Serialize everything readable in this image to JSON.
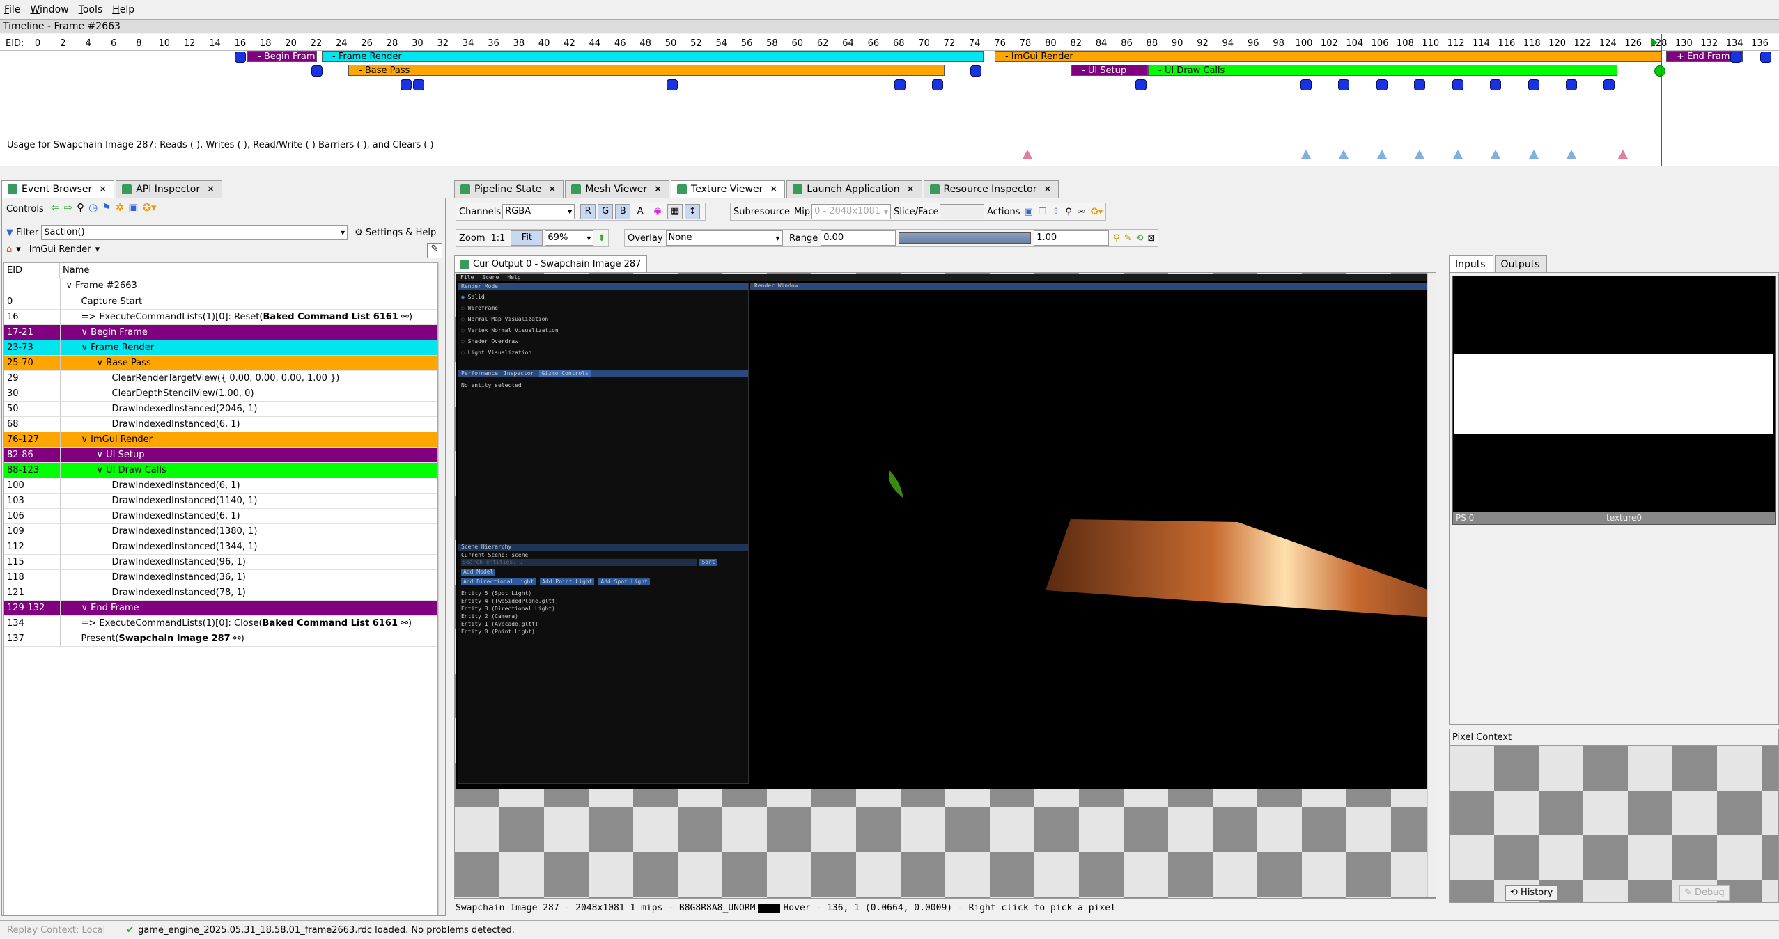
{
  "menu": [
    "File",
    "Window",
    "Tools",
    "Help"
  ],
  "timeline": {
    "title": "Timeline - Frame #2663",
    "eid_label": "EID:",
    "ticks": [
      "0",
      "2",
      "4",
      "6",
      "8",
      "10",
      "12",
      "14",
      "16",
      "18",
      "20",
      "22",
      "24",
      "26",
      "28",
      "30",
      "32",
      "34",
      "36",
      "38",
      "40",
      "42",
      "44",
      "46",
      "48",
      "50",
      "52",
      "54",
      "56",
      "58",
      "60",
      "62",
      "64",
      "66",
      "68",
      "70",
      "72",
      "74",
      "76",
      "78",
      "80",
      "82",
      "84",
      "86",
      "88",
      "90",
      "92",
      "94",
      "96",
      "98",
      "100",
      "102",
      "104",
      "106",
      "108",
      "110",
      "112",
      "114",
      "116",
      "118",
      "120",
      "122",
      "124",
      "126",
      "128",
      "130",
      "132",
      "134",
      "136"
    ],
    "bars": [
      {
        "label": "- Begin Frame",
        "color": "#800080",
        "text_color": "#ffffff"
      },
      {
        "label": "- Frame Render",
        "color": "#00e5ee",
        "text_color": "#000000"
      },
      {
        "label": "- Base Pass",
        "color": "#ffa500",
        "text_color": "#000000"
      },
      {
        "label": "- ImGui Render",
        "color": "#ffa500",
        "text_color": "#000000"
      },
      {
        "label": "- UI Setup",
        "color": "#800080",
        "text_color": "#ffffff"
      },
      {
        "label": "- UI Draw Calls",
        "color": "#00ff00",
        "text_color": "#000000"
      },
      {
        "label": "+ End Frame",
        "color": "#800080",
        "text_color": "#ffffff"
      }
    ],
    "usage_text": "Usage for Swapchain Image 287: Reads (  ), Writes (  ), Read/Write (  ) Barriers (  ), and Clears (  )"
  },
  "left_tabs": [
    "Event Browser",
    "API Inspector"
  ],
  "controls_label": "Controls",
  "filter": {
    "label": "Filter",
    "value": "$action()",
    "settings": "Settings & Help"
  },
  "breadcrumb": "ImGui Render",
  "columns": [
    "EID",
    "Name"
  ],
  "events": [
    {
      "eid": "",
      "name": "Frame #2663",
      "indent": 0,
      "color": ""
    },
    {
      "eid": "0",
      "name": "Capture Start",
      "indent": 1,
      "color": ""
    },
    {
      "eid": "16",
      "name": "=> ExecuteCommandLists(1)[0]: Reset(",
      "bold": "Baked Command List 6161",
      "tail": ")",
      "indent": 1,
      "color": ""
    },
    {
      "eid": "17-21",
      "name": "Begin Frame",
      "indent": 1,
      "color": "#800080",
      "fg": "#ffffff"
    },
    {
      "eid": "23-73",
      "name": "Frame Render",
      "indent": 1,
      "color": "#00e5ee",
      "fg": "#000000"
    },
    {
      "eid": "25-70",
      "name": "Base Pass",
      "indent": 2,
      "color": "#ffa500",
      "fg": "#000000"
    },
    {
      "eid": "29",
      "name": "ClearRenderTargetView({ 0.00, 0.00, 0.00, 1.00 })",
      "indent": 3,
      "color": ""
    },
    {
      "eid": "30",
      "name": "ClearDepthStencilView(1.00, 0)",
      "indent": 3,
      "color": ""
    },
    {
      "eid": "50",
      "name": "DrawIndexedInstanced(2046, 1)",
      "indent": 3,
      "color": ""
    },
    {
      "eid": "68",
      "name": "DrawIndexedInstanced(6, 1)",
      "indent": 3,
      "color": ""
    },
    {
      "eid": "76-127",
      "name": "ImGui Render",
      "indent": 1,
      "color": "#ffa500",
      "fg": "#000000"
    },
    {
      "eid": "82-86",
      "name": "UI Setup",
      "indent": 2,
      "color": "#800080",
      "fg": "#ffffff"
    },
    {
      "eid": "88-123",
      "name": "UI Draw Calls",
      "indent": 2,
      "color": "#00ff00",
      "fg": "#000000"
    },
    {
      "eid": "100",
      "name": "DrawIndexedInstanced(6, 1)",
      "indent": 3,
      "color": ""
    },
    {
      "eid": "103",
      "name": "DrawIndexedInstanced(1140, 1)",
      "indent": 3,
      "color": ""
    },
    {
      "eid": "106",
      "name": "DrawIndexedInstanced(6, 1)",
      "indent": 3,
      "color": ""
    },
    {
      "eid": "109",
      "name": "DrawIndexedInstanced(1380, 1)",
      "indent": 3,
      "color": ""
    },
    {
      "eid": "112",
      "name": "DrawIndexedInstanced(1344, 1)",
      "indent": 3,
      "color": ""
    },
    {
      "eid": "115",
      "name": "DrawIndexedInstanced(96, 1)",
      "indent": 3,
      "color": ""
    },
    {
      "eid": "118",
      "name": "DrawIndexedInstanced(36, 1)",
      "indent": 3,
      "color": ""
    },
    {
      "eid": "121",
      "name": "DrawIndexedInstanced(78, 1)",
      "indent": 3,
      "color": ""
    },
    {
      "eid": "129-132",
      "name": "End Frame",
      "indent": 1,
      "color": "#800080",
      "fg": "#ffffff"
    },
    {
      "eid": "134",
      "name": "=> ExecuteCommandLists(1)[0]: Close(",
      "bold": "Baked Command List 6161",
      "tail": ")",
      "indent": 1,
      "color": ""
    },
    {
      "eid": "137",
      "name": "Present(",
      "bold": "Swapchain Image 287",
      "tail": ")",
      "indent": 1,
      "color": ""
    }
  ],
  "right_tabs": [
    "Pipeline State",
    "Mesh Viewer",
    "Texture Viewer",
    "Launch Application",
    "Resource Inspector"
  ],
  "toolbar": {
    "channels_label": "Channels",
    "channels_value": "RGBA",
    "r": "R",
    "g": "G",
    "b": "B",
    "a": "A",
    "subresource": "Subresource",
    "mip_label": "Mip",
    "mip_value": "0 - 2048x1081",
    "slice_label": "Slice/Face",
    "actions": "Actions",
    "zoom_label": "Zoom",
    "zoom_1to1": "1:1",
    "fit": "Fit",
    "zoom_value": "69%",
    "overlay_label": "Overlay",
    "overlay_value": "None",
    "range_label": "Range",
    "range_min": "0.00",
    "range_max": "1.00"
  },
  "texture_tab": "Cur Output 0 - Swapchain Image 287",
  "game": {
    "menu": [
      "File",
      "Scene",
      "Help"
    ],
    "render_mode_header": "Render Mode",
    "render_modes": [
      "Solid",
      "Wireframe",
      "Normal Map Visualization",
      "Vertex Normal Visualization",
      "Shader Overdraw",
      "Light Visualization"
    ],
    "window_header": "Render Window",
    "perf_tabs": [
      "Performance",
      "Inspector",
      "Gizmo Controls"
    ],
    "no_entity": "No entity selected",
    "hierarchy_header": "Scene Hierarchy",
    "current_scene": "Current Scene: scene",
    "search_placeholder": "Search entities...",
    "sort": "Sort",
    "add_model": "Add Model",
    "add_buttons": [
      "Add Directional Light",
      "Add Point Light",
      "Add Spot Light"
    ],
    "entities": [
      "Entity 5 (Spot Light)",
      "Entity 4 (TwoSidedPlane.gltf)",
      "Entity 3 (Directional Light)",
      "Entity 2 (Camera)",
      "Entity 1 (Avocado.gltf)",
      "Entity 0 (Point Light)"
    ]
  },
  "texture_status": "Swapchain Image 287 - 2048x1081 1 mips - B8G8R8A8_UNORM",
  "hover_status": "Hover -    136,    1 (0.0664, 0.0009)  - Right click to pick a pixel",
  "io_tabs": [
    "Inputs",
    "Outputs"
  ],
  "thumb": {
    "left": "PS 0",
    "right": "texture0"
  },
  "pixel_context": "Pixel Context",
  "history": "History",
  "debug": "Debug",
  "statusbar": {
    "replay": "Replay Context: Local",
    "loaded": "game_engine_2025.05.31_18.58.01_frame2663.rdc loaded. No problems detected."
  },
  "colors": {
    "purple": "#800080",
    "cyan": "#00e5ee",
    "orange": "#ffa500",
    "green": "#00ff00",
    "marker_blue": "#1a32e0"
  }
}
